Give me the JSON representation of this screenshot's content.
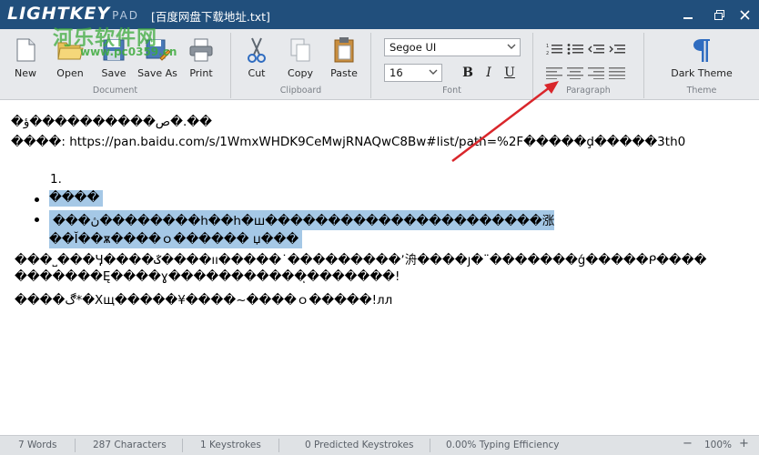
{
  "app": {
    "logo_main": "LIGHTKEY",
    "logo_sub": "PAD",
    "document_title": "[百度网盘下载地址.txt]",
    "watermark_cn": "河乐软件网",
    "watermark_url": "www.pc0359.cn"
  },
  "ribbon": {
    "document": {
      "label": "Document",
      "new": "New",
      "open": "Open",
      "save": "Save",
      "save_as": "Save As",
      "print": "Print"
    },
    "clipboard": {
      "label": "Clipboard",
      "cut": "Cut",
      "copy": "Copy",
      "paste": "Paste"
    },
    "font": {
      "label": "Font",
      "family": "Segoe UI",
      "size": "16",
      "bold": "B",
      "italic": "I",
      "underline": "U"
    },
    "paragraph": {
      "label": "Paragraph"
    },
    "theme": {
      "label": "Theme",
      "dark_theme": "Dark Theme"
    }
  },
  "editor": {
    "line1": "�ص����������ؤ�.��",
    "line2": "����: https://pan.baidu.com/s/1WmxWHDK9CeMwjRNAQwC8Bw#list/path=%2F�����ḑ�����3th0",
    "list_number": "1.",
    "bullet1": "����",
    "bullet2a": "���ڽ��������h��h�ш����������������������涨",
    "bullet2b": "��Ĭ��ѫ����ｏ������ џ���",
    "line3": "���˽���Ӌ����ػ����ıı�����˙���������ʼ洀����ȷ�¨�������ǵ�����ᑭ����",
    "line4": "�������Ę����ɣ�����������ͅ�������!",
    "line5": "����ڰ*�Xщ�����¥����~����ｏ�����!лл"
  },
  "status": {
    "words": "7 Words",
    "characters": "287 Characters",
    "keystrokes": "1 Keystrokes",
    "predicted": "0 Predicted Keystrokes",
    "efficiency": "0.00% Typing Efficiency",
    "zoom": "100%",
    "zoom_minus": "−",
    "zoom_plus": "+"
  },
  "colors": {
    "titlebar": "#214f7c",
    "ribbon": "#e7e9ec",
    "highlight": "#a5c8e6",
    "arrow": "#d9262b",
    "status": "#dfe2e5"
  }
}
